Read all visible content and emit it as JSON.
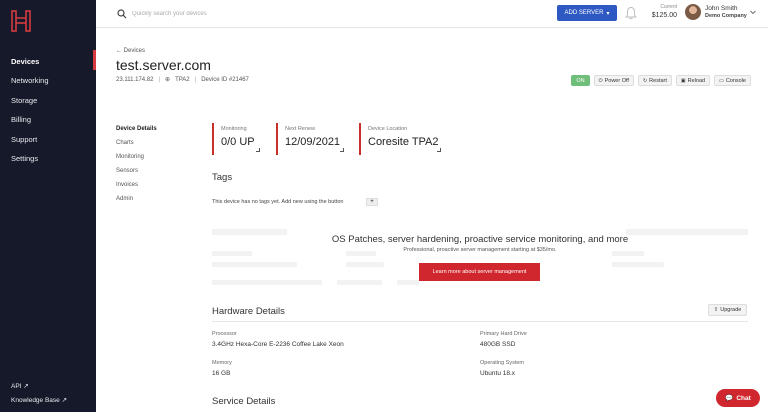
{
  "sidebar": {
    "items": [
      {
        "label": "Devices",
        "active": true
      },
      {
        "label": "Networking"
      },
      {
        "label": "Storage"
      },
      {
        "label": "Billing"
      },
      {
        "label": "Support"
      },
      {
        "label": "Settings"
      }
    ],
    "footer": [
      {
        "label": "API ↗"
      },
      {
        "label": "Knowledge Base ↗"
      }
    ],
    "accent": "#d43a3f",
    "bg": "#16192a"
  },
  "topbar": {
    "search_placeholder": "Quickly search your devices",
    "add_server_label": "ADD SERVER",
    "balance_label": "Current",
    "balance_value": "$125.00",
    "user_name": "John Smith",
    "user_company": "Demo Company"
  },
  "header": {
    "back_label": "Devices",
    "title": "test.server.com",
    "ip": "23.111.174.82",
    "location": "TPA2",
    "device_id": "Device ID #21467",
    "actions": {
      "on": "ON",
      "power_off": "Power Off",
      "restart": "Restart",
      "reload": "Reload",
      "console": "Console"
    }
  },
  "subnav": [
    "Device Details",
    "Charts",
    "Monitoring",
    "Sensors",
    "Invoices",
    "Admin"
  ],
  "stats": [
    {
      "label": "Monitoring",
      "value": "0/0 UP"
    },
    {
      "label": "Next Renew",
      "value": "12/09/2021"
    },
    {
      "label": "Device Location",
      "value": "Coresite TPA2"
    }
  ],
  "tags": {
    "heading": "Tags",
    "empty_text": "This device has no tags yet. Add new using the button",
    "add_label": "+"
  },
  "promo": {
    "title": "OS Patches, server hardening, proactive service monitoring, and more",
    "subtitle": "Professional, proactive server management starting at $35/mo.",
    "button": "Learn more about server management"
  },
  "hardware": {
    "heading": "Hardware Details",
    "upgrade_label": "Upgrade",
    "processor_label": "Processor",
    "processor_value": "3.4GHz Hexa-Core E-2236 Coffee Lake Xeon",
    "drive_label": "Primary Hard Drive",
    "drive_value": "480GB SSD",
    "memory_label": "Memory",
    "memory_value": "16 GB",
    "os_label": "Operating System",
    "os_value": "Ubuntu 18.x"
  },
  "service": {
    "heading": "Service Details"
  },
  "chat": {
    "label": "Chat"
  }
}
